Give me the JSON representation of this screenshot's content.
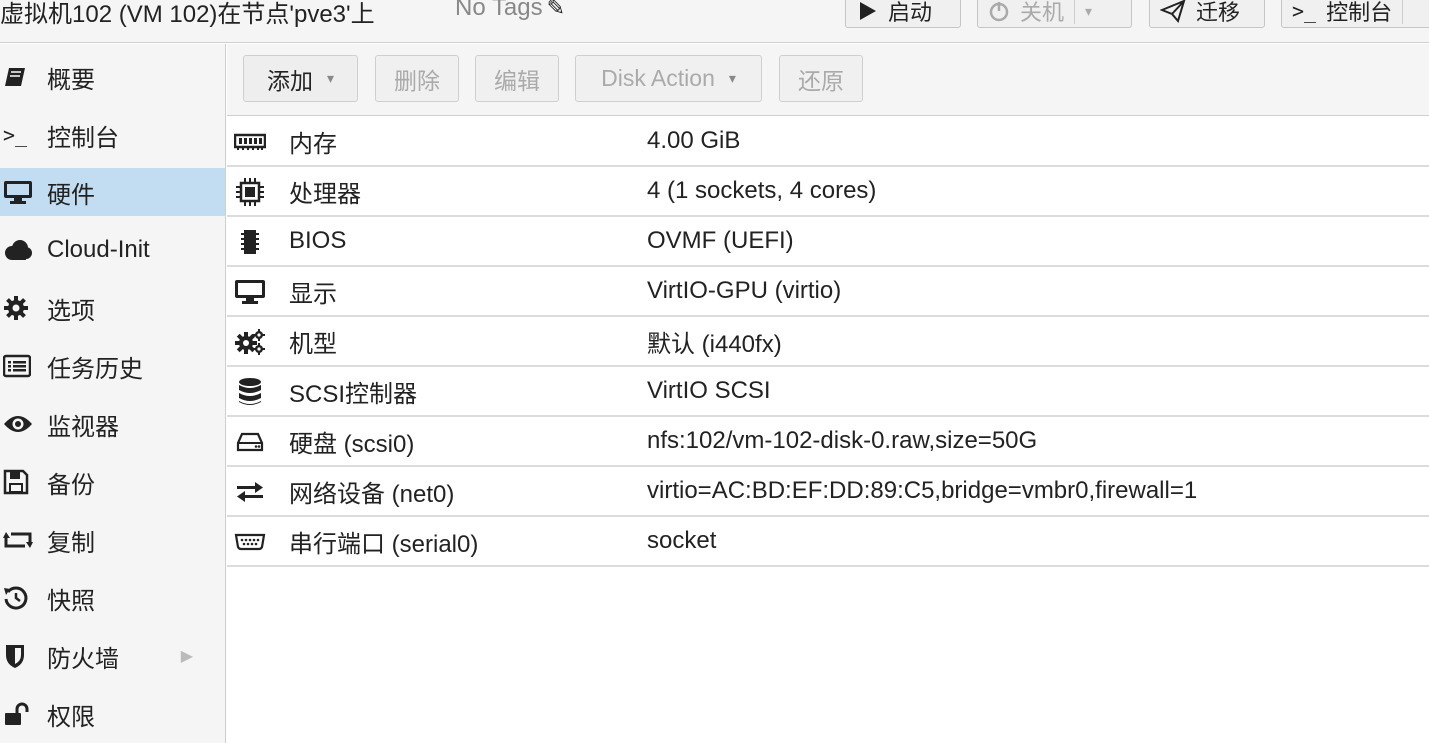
{
  "header": {
    "vm_title": "虚拟机102 (VM 102)在节点'pve3'上",
    "tags": "No Tags",
    "start_label": "启动",
    "shutdown_label": "关机",
    "migrate_label": "迁移",
    "console_label": "控制台"
  },
  "sidebar": {
    "items": [
      {
        "label": "概要",
        "icon": "book-icon"
      },
      {
        "label": "控制台",
        "icon": "terminal-icon"
      },
      {
        "label": "硬件",
        "icon": "desktop-icon",
        "active": true
      },
      {
        "label": "Cloud-Init",
        "icon": "cloud-icon"
      },
      {
        "label": "选项",
        "icon": "gear-icon"
      },
      {
        "label": "任务历史",
        "icon": "list-icon"
      },
      {
        "label": "监视器",
        "icon": "eye-icon"
      },
      {
        "label": "备份",
        "icon": "floppy-icon"
      },
      {
        "label": "复制",
        "icon": "retweet-icon"
      },
      {
        "label": "快照",
        "icon": "history-icon"
      },
      {
        "label": "防火墙",
        "icon": "shield-icon"
      },
      {
        "label": "权限",
        "icon": "unlock-icon"
      }
    ]
  },
  "toolbar": {
    "add_label": "添加",
    "remove_label": "删除",
    "edit_label": "编辑",
    "disk_action_label": "Disk Action",
    "revert_label": "还原"
  },
  "hardware": {
    "rows": [
      {
        "name": "内存",
        "value": "4.00 GiB",
        "icon": "memory-icon"
      },
      {
        "name": "处理器",
        "value": "4 (1 sockets, 4 cores)",
        "icon": "cpu-icon"
      },
      {
        "name": "BIOS",
        "value": "OVMF (UEFI)",
        "icon": "microchip-icon"
      },
      {
        "name": "显示",
        "value": "VirtIO-GPU (virtio)",
        "icon": "desktop-icon"
      },
      {
        "name": "机型",
        "value": "默认 (i440fx)",
        "icon": "cogs-icon"
      },
      {
        "name": "SCSI控制器",
        "value": "VirtIO SCSI",
        "icon": "database-icon"
      },
      {
        "name": "硬盘 (scsi0)",
        "value": "nfs:102/vm-102-disk-0.raw,size=50G",
        "icon": "hdd-icon"
      },
      {
        "name": "网络设备 (net0)",
        "value": "virtio=AC:BD:EF:DD:89:C5,bridge=vmbr0,firewall=1",
        "icon": "exchange-icon"
      },
      {
        "name": "串行端口 (serial0)",
        "value": "socket",
        "icon": "serial-icon"
      }
    ]
  }
}
